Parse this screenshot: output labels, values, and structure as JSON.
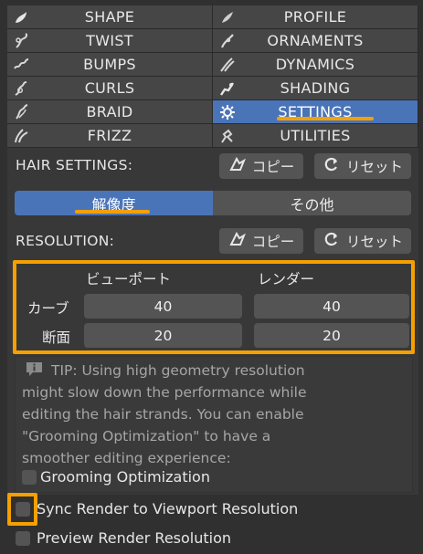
{
  "tabs": [
    {
      "label": "SHAPE",
      "icon": "shape-icon"
    },
    {
      "label": "PROFILE",
      "icon": "profile-icon"
    },
    {
      "label": "TWIST",
      "icon": "twist-icon"
    },
    {
      "label": "ORNAMENTS",
      "icon": "ornaments-icon"
    },
    {
      "label": "BUMPS",
      "icon": "bumps-icon"
    },
    {
      "label": "DYNAMICS",
      "icon": "dynamics-icon"
    },
    {
      "label": "CURLS",
      "icon": "curls-icon"
    },
    {
      "label": "SHADING",
      "icon": "shading-icon"
    },
    {
      "label": "BRAID",
      "icon": "braid-icon"
    },
    {
      "label": "SETTINGS",
      "icon": "gear-icon",
      "active": true
    },
    {
      "label": "FRIZZ",
      "icon": "frizz-icon"
    },
    {
      "label": "UTILITIES",
      "icon": "utilities-icon"
    }
  ],
  "hair_settings": {
    "label": "HAIR SETTINGS:",
    "copy_label": "コピー",
    "reset_label": "リセット"
  },
  "segment": {
    "resolution": "解像度",
    "other": "その他"
  },
  "resolution": {
    "label": "RESOLUTION:",
    "copy_label": "コピー",
    "reset_label": "リセット",
    "viewport_header": "ビューポート",
    "render_header": "レンダー",
    "curve_label": "カーブ",
    "section_label": "断面",
    "curve_viewport": "40",
    "curve_render": "40",
    "section_viewport": "20",
    "section_render": "20"
  },
  "tip": {
    "line1": "TIP:  Using high geometry resolution",
    "line2": "might slow down the performance while",
    "line3": "editing the hair strands. You can enable",
    "line4": "\"Grooming Optimization\" to have a",
    "line5": "smoother editing experience:"
  },
  "checkboxes": {
    "grooming": "Grooming Optimization",
    "sync": "Sync Render to Viewport Resolution",
    "preview": "Preview Render Resolution"
  },
  "colors": {
    "accent": "#4a74b8",
    "highlight": "#f5a000"
  }
}
